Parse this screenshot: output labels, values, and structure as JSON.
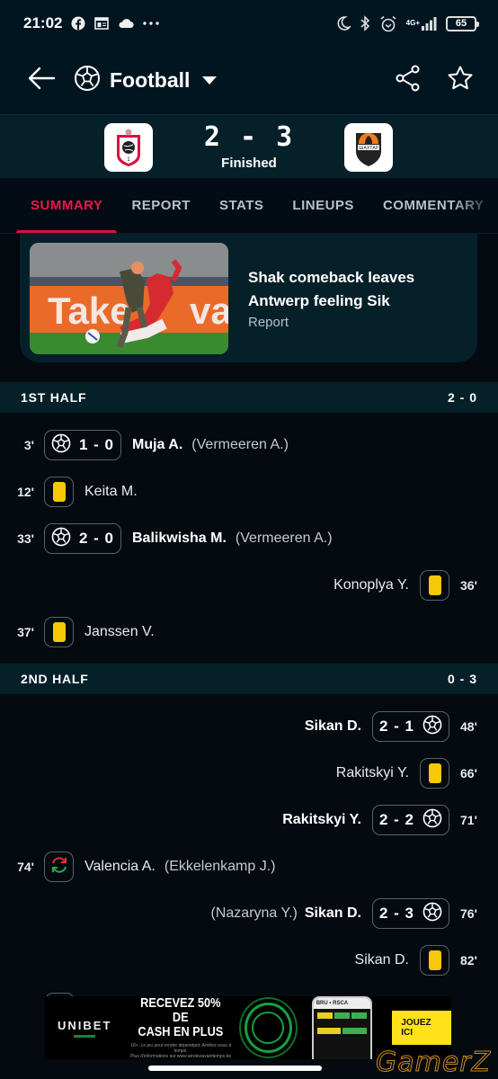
{
  "status_bar": {
    "time": "21:02",
    "left_icons": [
      "facebook-icon",
      "calendar-icon",
      "cloud-icon",
      "more-dots-icon"
    ],
    "right_icons": [
      "moon-icon",
      "bluetooth-icon",
      "alarm-icon",
      "signal-icon"
    ],
    "network": "4G+",
    "battery": "65"
  },
  "app_bar": {
    "sport": "Football",
    "back_icon": "arrow-left-icon",
    "share_icon": "share-icon",
    "favorite_icon": "star-icon"
  },
  "match": {
    "home_team": "Antwerp",
    "away_team": "Shakhtar",
    "score": "2 - 3",
    "status": "Finished"
  },
  "tabs": [
    {
      "label": "SUMMARY",
      "active": true
    },
    {
      "label": "REPORT",
      "active": false
    },
    {
      "label": "STATS",
      "active": false
    },
    {
      "label": "LINEUPS",
      "active": false
    },
    {
      "label": "COMMENTARY",
      "active": false
    }
  ],
  "news": {
    "title": "Shak comeback leaves Antwerp feeling Sik",
    "type": "Report"
  },
  "sections": [
    {
      "label": "1ST HALF",
      "score": "2 - 0",
      "events": [
        {
          "side": "home",
          "minute": "3'",
          "type": "goal",
          "score": "1 - 0",
          "player": "Muja A.",
          "assist": "(Vermeeren A.)"
        },
        {
          "side": "home",
          "minute": "12'",
          "type": "yellow-card",
          "player": "Keita M."
        },
        {
          "side": "home",
          "minute": "33'",
          "type": "goal",
          "score": "2 - 0",
          "player": "Balikwisha M.",
          "assist": "(Vermeeren A.)"
        },
        {
          "side": "away",
          "minute": "36'",
          "type": "yellow-card",
          "player": "Konoplya Y."
        },
        {
          "side": "home",
          "minute": "37'",
          "type": "yellow-card",
          "player": "Janssen V."
        }
      ]
    },
    {
      "label": "2ND HALF",
      "score": "0 - 3",
      "events": [
        {
          "side": "away",
          "minute": "48'",
          "type": "goal",
          "score": "2 - 1",
          "player": "Sikan D."
        },
        {
          "side": "away",
          "minute": "66'",
          "type": "yellow-card",
          "player": "Rakitskyi Y."
        },
        {
          "side": "away",
          "minute": "71'",
          "type": "goal",
          "score": "2 - 2",
          "player": "Rakitskyi Y."
        },
        {
          "side": "home",
          "minute": "74'",
          "type": "substitution",
          "player": "Valencia A.",
          "assist": "(Ekkelenkamp J.)"
        },
        {
          "side": "away",
          "minute": "76'",
          "type": "goal",
          "score": "2 - 3",
          "player": "Sikan D.",
          "assist": "(Nazaryna Y.)"
        },
        {
          "side": "away",
          "minute": "82'",
          "type": "yellow-card",
          "player": "Sikan D."
        }
      ]
    }
  ],
  "ad": {
    "brand": "UNIBET",
    "headline_1": "RECEVEZ 50% DE",
    "headline_2": "CASH EN PLUS",
    "disclaimer_1": "18+. Le jeu peut rendre dépendant. Arrêtez-vous à temps.",
    "disclaimer_2": "Plus d'informations sur www.arretezavanttemps.be",
    "phone_header": "BRU  •  RSCA",
    "cta": "JOUEZ ICI"
  },
  "watermark": "GamerZ",
  "colors": {
    "accent": "#d8123f",
    "yellow_card": "#f6c808",
    "header_bg": "#001520",
    "section_bg": "#06202a"
  }
}
